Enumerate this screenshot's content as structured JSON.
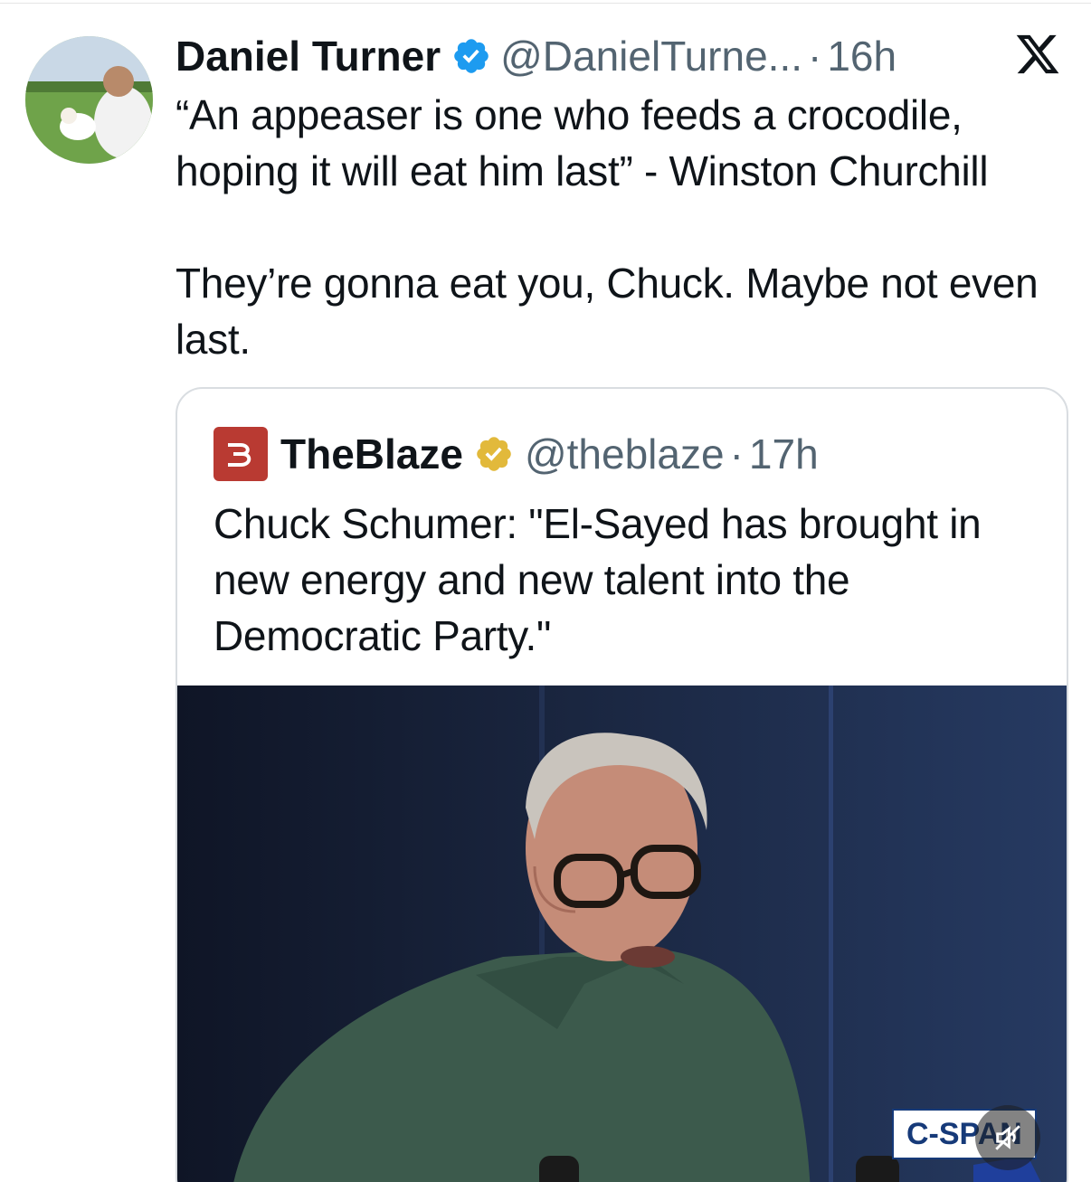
{
  "tweet": {
    "author_name": "Daniel Turner",
    "handle": "@DanielTurne...",
    "separator": "·",
    "time": "16h",
    "text": "“An appeaser is one who feeds a crocodile, hoping it will eat him last” - Winston Churchill\n\nThey’re gonna eat you, Chuck. Maybe not even last.",
    "icons": {
      "verified": "verified-badge-blue",
      "brand": "x-logo"
    }
  },
  "quote": {
    "author_name": "TheBlaze",
    "handle": "@theblaze",
    "separator": "·",
    "time": "17h",
    "text": "Chuck Schumer: \"El-Sayed has brought in new energy and new talent into the Democratic Party.\"",
    "media": {
      "badge_text": "C-SPAN",
      "icons": {
        "mute": "muted-speaker-icon"
      }
    }
  },
  "colors": {
    "verified_blue": "#1d9bf0",
    "gold_badge": "#e2b93b",
    "blaze_red": "#b93a32",
    "secondary_text": "#536471"
  }
}
